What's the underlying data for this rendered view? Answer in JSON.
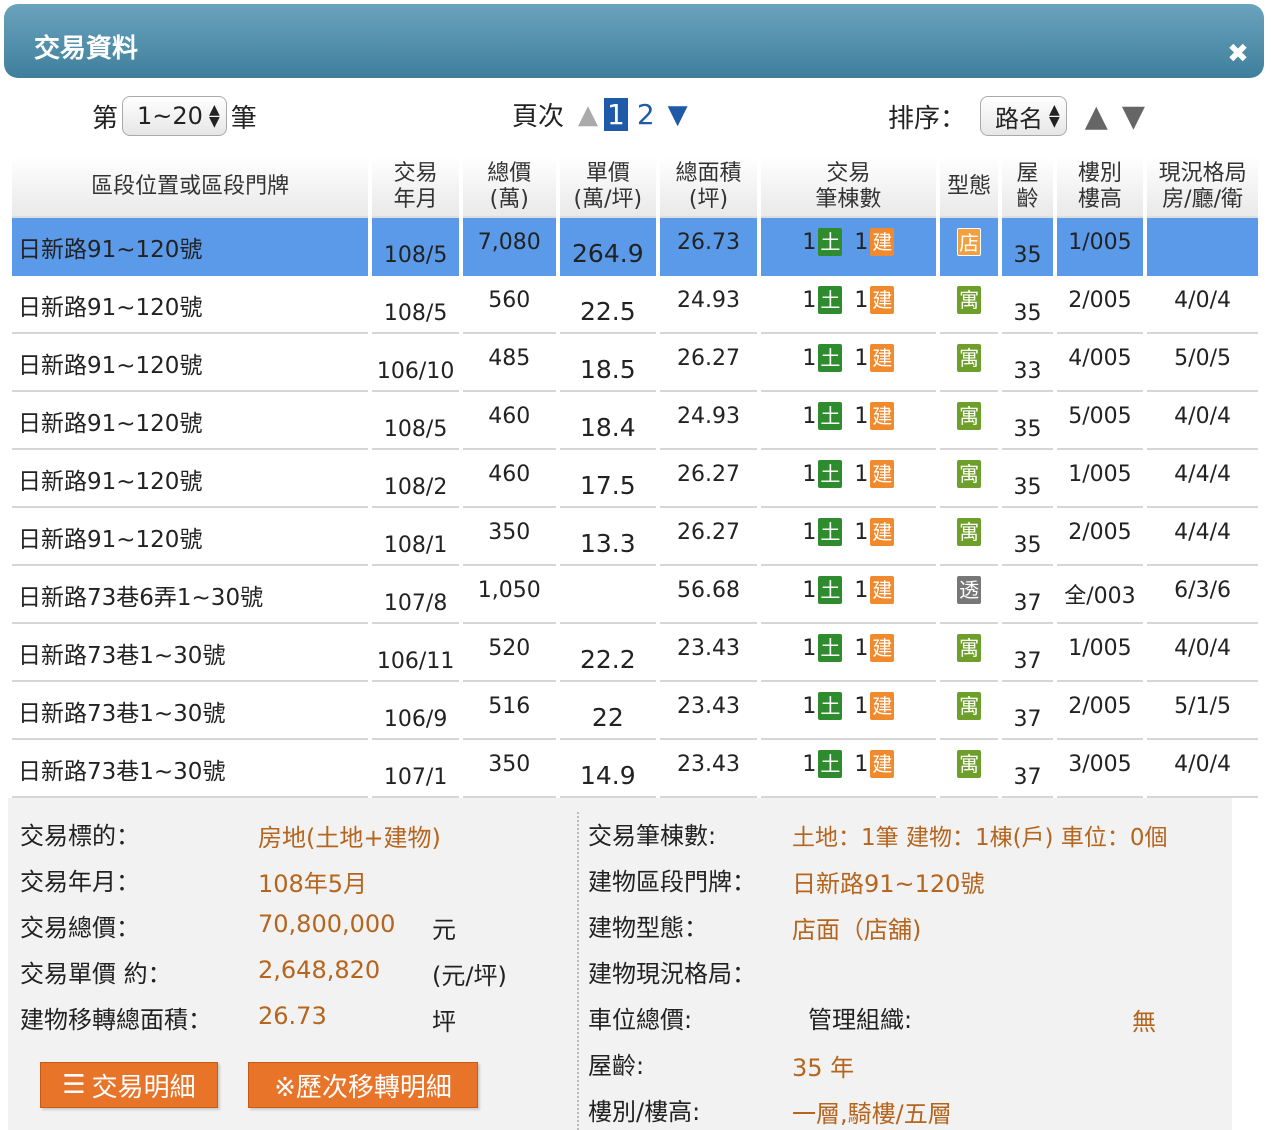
{
  "window": {
    "title": "交易資料",
    "close_icon": "✖"
  },
  "controls": {
    "range_prefix": "第",
    "range_value": "1~20",
    "range_suffix": "筆",
    "page_label": "頁次",
    "pages": [
      "1",
      "2"
    ],
    "current_page": "1",
    "sort_label": "排序：",
    "sort_value": "路名"
  },
  "table": {
    "headers": [
      "區段位置或區段門牌",
      "交易\n年月",
      "總價\n(萬)",
      "單價\n(萬/坪)",
      "總面積\n(坪)",
      "交易\n筆棟數",
      "型態",
      "屋\n齡",
      "樓別\n樓高",
      "現況格局\n房/廳/衛"
    ],
    "rows": [
      {
        "addr": "日新路91~120號",
        "ym": "108/5",
        "total": "7,080",
        "unit": "264.9",
        "area": "26.73",
        "land": "1",
        "land_badge": "土",
        "bldg": "1",
        "bldg_badge": "建",
        "type": "店",
        "type_kind": "shop",
        "age": "35",
        "floor": "1/005",
        "layout": ""
      },
      {
        "addr": "日新路91~120號",
        "ym": "108/5",
        "total": "560",
        "unit": "22.5",
        "area": "24.93",
        "land": "1",
        "land_badge": "土",
        "bldg": "1",
        "bldg_badge": "建",
        "type": "寓",
        "type_kind": "res",
        "age": "35",
        "floor": "2/005",
        "layout": "4/0/4"
      },
      {
        "addr": "日新路91~120號",
        "ym": "106/10",
        "total": "485",
        "unit": "18.5",
        "area": "26.27",
        "land": "1",
        "land_badge": "土",
        "bldg": "1",
        "bldg_badge": "建",
        "type": "寓",
        "type_kind": "res",
        "age": "33",
        "floor": "4/005",
        "layout": "5/0/5"
      },
      {
        "addr": "日新路91~120號",
        "ym": "108/5",
        "total": "460",
        "unit": "18.4",
        "area": "24.93",
        "land": "1",
        "land_badge": "土",
        "bldg": "1",
        "bldg_badge": "建",
        "type": "寓",
        "type_kind": "res",
        "age": "35",
        "floor": "5/005",
        "layout": "4/0/4"
      },
      {
        "addr": "日新路91~120號",
        "ym": "108/2",
        "total": "460",
        "unit": "17.5",
        "area": "26.27",
        "land": "1",
        "land_badge": "土",
        "bldg": "1",
        "bldg_badge": "建",
        "type": "寓",
        "type_kind": "res",
        "age": "35",
        "floor": "1/005",
        "layout": "4/4/4"
      },
      {
        "addr": "日新路91~120號",
        "ym": "108/1",
        "total": "350",
        "unit": "13.3",
        "area": "26.27",
        "land": "1",
        "land_badge": "土",
        "bldg": "1",
        "bldg_badge": "建",
        "type": "寓",
        "type_kind": "res",
        "age": "35",
        "floor": "2/005",
        "layout": "4/4/4"
      },
      {
        "addr": "日新路73巷6弄1~30號",
        "ym": "107/8",
        "total": "1,050",
        "unit": "",
        "area": "56.68",
        "land": "1",
        "land_badge": "土",
        "bldg": "1",
        "bldg_badge": "建",
        "type": "透",
        "type_kind": "tow",
        "age": "37",
        "floor": "全/003",
        "layout": "6/3/6"
      },
      {
        "addr": "日新路73巷1~30號",
        "ym": "106/11",
        "total": "520",
        "unit": "22.2",
        "area": "23.43",
        "land": "1",
        "land_badge": "土",
        "bldg": "1",
        "bldg_badge": "建",
        "type": "寓",
        "type_kind": "res",
        "age": "37",
        "floor": "1/005",
        "layout": "4/0/4"
      },
      {
        "addr": "日新路73巷1~30號",
        "ym": "106/9",
        "total": "516",
        "unit": "22",
        "area": "23.43",
        "land": "1",
        "land_badge": "土",
        "bldg": "1",
        "bldg_badge": "建",
        "type": "寓",
        "type_kind": "res",
        "age": "37",
        "floor": "2/005",
        "layout": "5/1/5"
      },
      {
        "addr": "日新路73巷1~30號",
        "ym": "107/1",
        "total": "350",
        "unit": "14.9",
        "area": "23.43",
        "land": "1",
        "land_badge": "土",
        "bldg": "1",
        "bldg_badge": "建",
        "type": "寓",
        "type_kind": "res",
        "age": "37",
        "floor": "3/005",
        "layout": "4/0/4"
      }
    ]
  },
  "detail": {
    "left": {
      "target_label": "交易標的：",
      "target_value": "房地(土地+建物)",
      "date_label": "交易年月：",
      "date_value": "108年5月",
      "total_label": "交易總價：",
      "total_value": "70,800,000",
      "total_unit": "元",
      "unit_label": "交易單價 約：",
      "unit_value": "2,648,820",
      "unit_unit": "(元/坪)",
      "area_label": "建物移轉總面積：",
      "area_value": "26.73",
      "area_unit": "坪"
    },
    "right": {
      "count_label": "交易筆棟數:",
      "count_value": "土地：1筆 建物：1棟(戶) 車位：0個",
      "addr_label": "建物區段門牌：",
      "addr_value": "日新路91~120號",
      "type_label": "建物型態：",
      "type_value": "店面（店舖)",
      "layout_label": "建物現況格局：",
      "layout_value": "",
      "parking_label": "車位總價:",
      "mgmt_label": "管理組織:",
      "mgmt_value": "無",
      "age_label": "屋齡:",
      "age_value": "35 年",
      "floor_label": "樓別/樓高:",
      "floor_value": "一層,騎樓/五層"
    },
    "buttons": {
      "detail_icon": "☰",
      "detail_label": "交易明細",
      "history_label": "※歷次移轉明細"
    }
  },
  "colors": {
    "titlebar": "#4f8fac",
    "selected_row": "#5b9ae8",
    "value_text": "#b5651d",
    "button": "#e8742a",
    "land_badge": "#2e8b2e",
    "bldg_badge": "#f08a2c"
  }
}
